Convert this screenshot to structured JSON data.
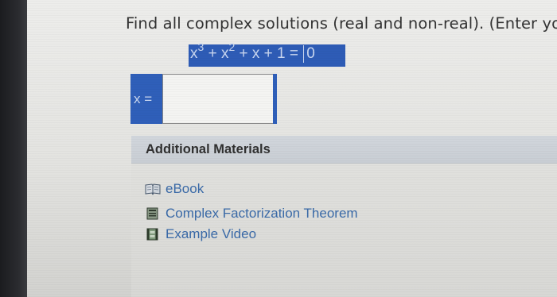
{
  "question": {
    "text": "Find all complex solutions (real and non-real). (Enter you"
  },
  "equation": {
    "base1": "x",
    "exp1": "3",
    "mid": " + x",
    "exp2": "2",
    "tail": " + x + 1 = ",
    "rhs": "0"
  },
  "answer": {
    "label": "x =",
    "value": ""
  },
  "additional_materials": {
    "title": "Additional Materials",
    "items": [
      {
        "label": "eBook",
        "icon": "book-icon"
      },
      {
        "label": "Complex Factorization Theorem",
        "icon": "document-icon"
      },
      {
        "label": "Example Video",
        "icon": "video-icon"
      }
    ]
  },
  "colors": {
    "accent_blue": "#2f5fb9",
    "link_blue": "#3a6aa8"
  }
}
